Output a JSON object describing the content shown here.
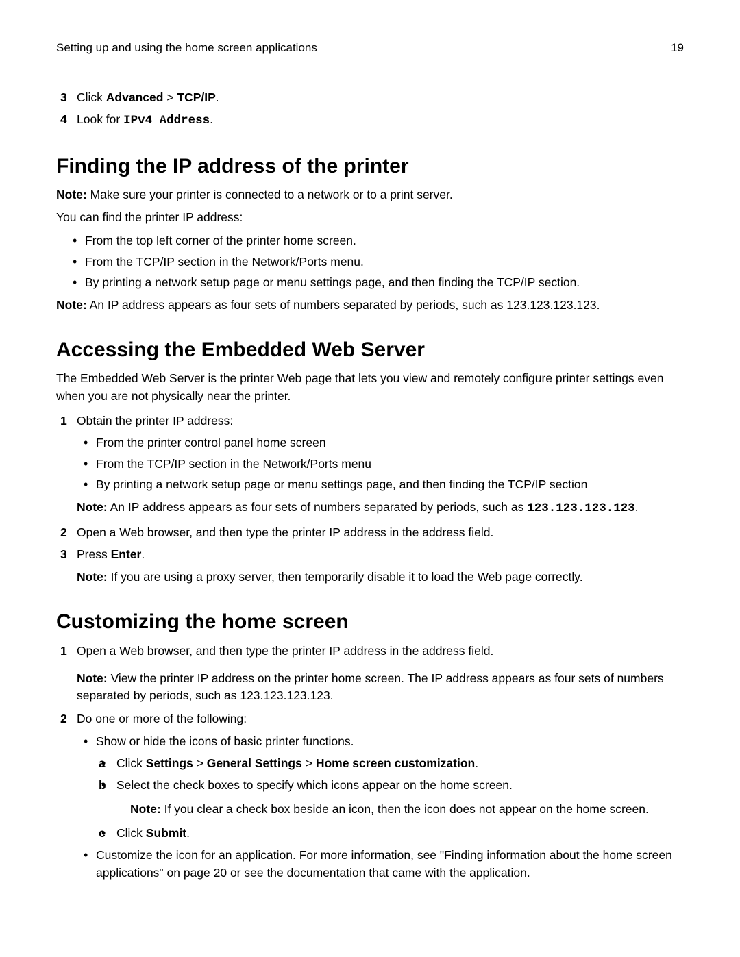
{
  "header": {
    "title": "Setting up and using the home screen applications",
    "page": "19"
  },
  "steps_intro": [
    {
      "num": "3",
      "pre": "Click ",
      "b1": "Advanced",
      "mid": " > ",
      "b2": "TCP/IP",
      "post": "."
    },
    {
      "num": "4",
      "pre": "Look for ",
      "code": "IPv4 Address",
      "post": "."
    }
  ],
  "sec1": {
    "title": "Finding the IP address of the printer",
    "note1a": "Note:",
    "note1b": " Make sure your printer is connected to a network or to a print server.",
    "intro": "You can find the printer IP address:",
    "bullets": [
      "From the top left corner of the printer home screen.",
      "From the TCP/IP section in the Network/Ports menu.",
      "By printing a network setup page or menu settings page, and then finding the TCP/IP section."
    ],
    "note2a": "Note:",
    "note2b": " An IP address appears as four sets of numbers separated by periods, such as 123.123.123.123."
  },
  "sec2": {
    "title": "Accessing the Embedded Web Server",
    "intro": "The Embedded Web Server is the printer Web page that lets you view and remotely configure printer settings even when you are not physically near the printer.",
    "step1": {
      "num": "1",
      "text": "Obtain the printer IP address:"
    },
    "bullets": [
      "From the printer control panel home screen",
      "From the TCP/IP section in the Network/Ports menu",
      "By printing a network setup page or menu settings page, and then finding the TCP/IP section"
    ],
    "note_inner_a": "Note:",
    "note_inner_b": " An IP address appears as four sets of numbers separated by periods, such as ",
    "note_inner_code": "123.123.123.123",
    "note_inner_c": ".",
    "step2": {
      "num": "2",
      "text": "Open a Web browser, and then type the printer IP address in the address field."
    },
    "step3": {
      "num": "3",
      "pre": "Press ",
      "b": "Enter",
      "post": "."
    },
    "note3a": "Note:",
    "note3b": " If you are using a proxy server, then temporarily disable it to load the Web page correctly."
  },
  "sec3": {
    "title": "Customizing the home screen",
    "step1": {
      "num": "1",
      "text": "Open a Web browser, and then type the printer IP address in the address field."
    },
    "note1a": "Note:",
    "note1b": " View the printer IP address on the printer home screen. The IP address appears as four sets of numbers separated by periods, such as 123.123.123.123.",
    "step2": {
      "num": "2",
      "text": "Do one or more of the following:"
    },
    "b1": "Show or hide the icons of basic printer functions.",
    "la": {
      "let": "a",
      "pre": "Click ",
      "s1": "Settings",
      "g1": " > ",
      "s2": "General Settings",
      "g2": " > ",
      "s3": "Home screen customization",
      "post": "."
    },
    "lb": {
      "let": "b",
      "text": "Select the check boxes to specify which icons appear on the home screen."
    },
    "lb_note_a": "Note:",
    "lb_note_b": " If you clear a check box beside an icon, then the icon does not appear on the home screen.",
    "lc": {
      "let": "c",
      "pre": "Click ",
      "b": "Submit",
      "post": "."
    },
    "b2": "Customize the icon for an application. For more information, see \"Finding information about the home screen applications\" on page 20 or see the documentation that came with the application."
  }
}
